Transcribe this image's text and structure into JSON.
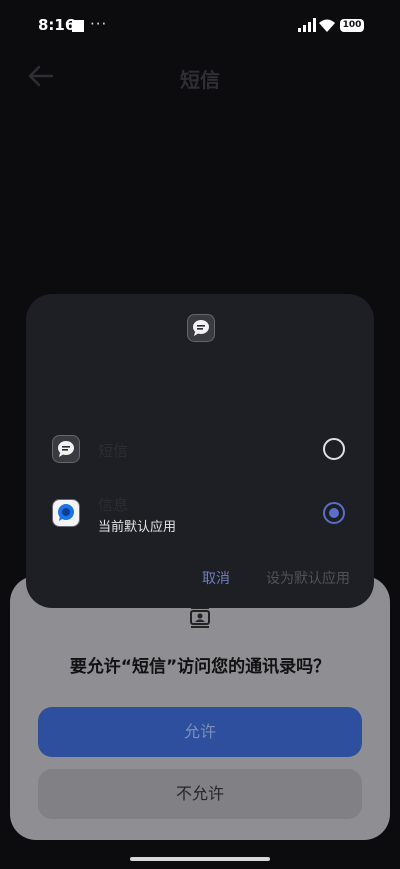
{
  "status_bar": {
    "time": "8:16",
    "extra": "···",
    "battery": "100"
  },
  "header": {
    "title": "短信"
  },
  "chooser": {
    "items": [
      {
        "name": "短信",
        "subtitle": "",
        "selected": false
      },
      {
        "name": "信息",
        "subtitle": "当前默认应用",
        "selected": true
      }
    ],
    "cancel_label": "取消",
    "set_default_label": "设为默认应用"
  },
  "permission": {
    "question": "要允许“短信”访问您的通讯录吗？",
    "allow_label": "允许",
    "deny_label": "不允许"
  }
}
